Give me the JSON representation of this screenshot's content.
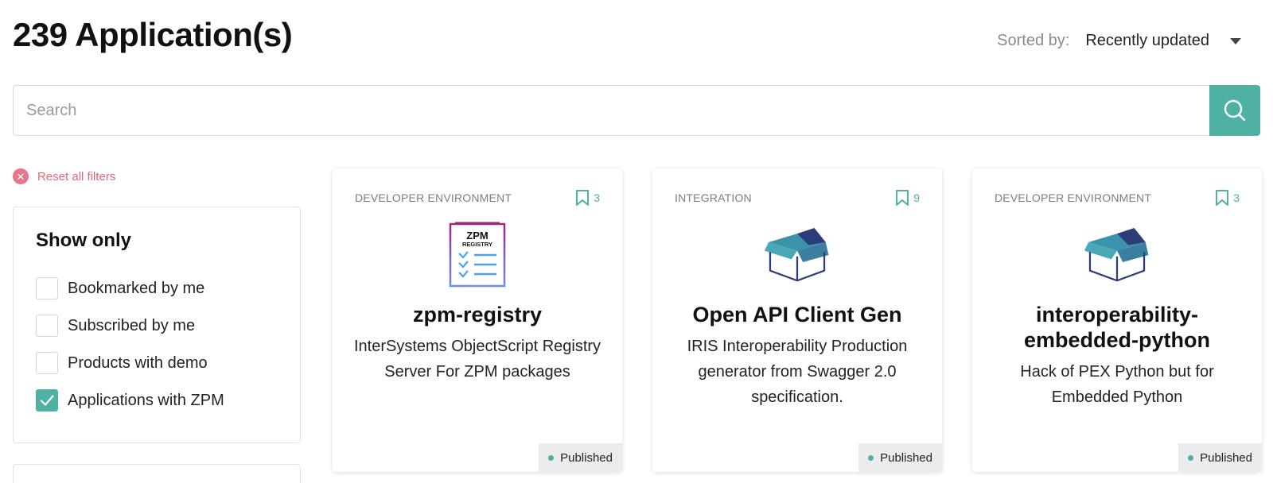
{
  "header": {
    "title": "239 Application(s)",
    "sort_label": "Sorted by:",
    "sort_value": "Recently updated"
  },
  "search": {
    "placeholder": "Search",
    "value": ""
  },
  "filters": {
    "reset_label": "Reset all filters",
    "heading": "Show only",
    "options": [
      {
        "label": "Bookmarked by me",
        "checked": false
      },
      {
        "label": "Subscribed by me",
        "checked": false
      },
      {
        "label": "Products with demo",
        "checked": false
      },
      {
        "label": "Applications with ZPM",
        "checked": true
      }
    ]
  },
  "cards": [
    {
      "category": "DEVELOPER ENVIRONMENT",
      "bookmarks": "3",
      "logo": "zpm-registry-logo",
      "logo_text_1": "ZPM",
      "logo_text_2": "REGISTRY",
      "title": "zpm-registry",
      "description": "InterSystems ObjectScript Registry Server For ZPM packages",
      "status": "Published"
    },
    {
      "category": "INTEGRATION",
      "bookmarks": "9",
      "logo": "package-box-logo",
      "title": "Open API Client Gen",
      "description": "IRIS Interoperability Production generator from Swagger 2.0 specification.",
      "status": "Published"
    },
    {
      "category": "DEVELOPER ENVIRONMENT",
      "bookmarks": "3",
      "logo": "package-box-logo",
      "title": "interoperability-embedded-python",
      "description": "Hack of PEX Python but for Embedded Python",
      "status": "Published"
    }
  ],
  "colors": {
    "accent": "#4fb0a4",
    "reset": "#e0677a",
    "box_teal": "#3a93a8",
    "box_navy": "#2c3d7a"
  }
}
